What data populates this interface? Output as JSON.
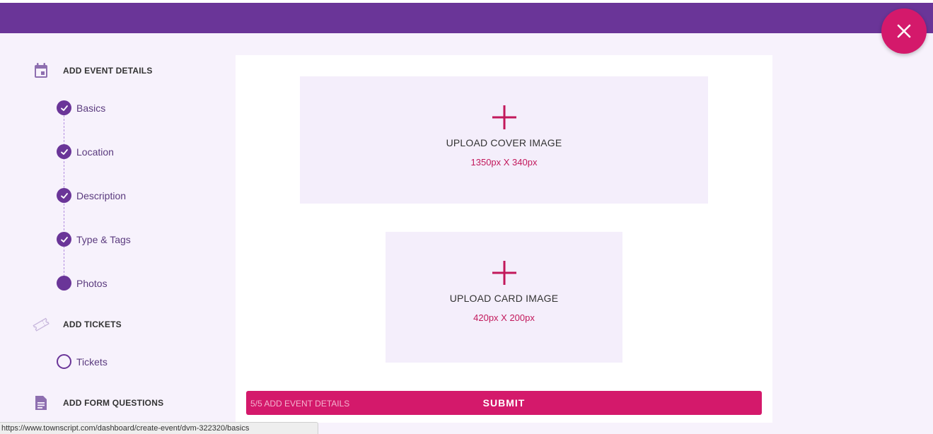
{
  "colors": {
    "brand": "#6a3598",
    "accent": "#d4196b"
  },
  "header": {
    "close_icon": "close-icon"
  },
  "sidebar": {
    "sections": [
      {
        "title": "ADD EVENT DETAILS",
        "icon": "calendar-icon",
        "steps": [
          {
            "label": "Basics",
            "status": "done"
          },
          {
            "label": "Location",
            "status": "done"
          },
          {
            "label": "Description",
            "status": "done"
          },
          {
            "label": "Type & Tags",
            "status": "done"
          },
          {
            "label": "Photos",
            "status": "current"
          }
        ]
      },
      {
        "title": "ADD TICKETS",
        "icon": "ticket-icon",
        "steps": [
          {
            "label": "Tickets",
            "status": "pending"
          }
        ]
      },
      {
        "title": "ADD FORM QUESTIONS",
        "icon": "document-icon",
        "steps": []
      }
    ]
  },
  "main": {
    "cover_upload": {
      "label": "UPLOAD COVER IMAGE",
      "size": "1350px X 340px"
    },
    "card_upload": {
      "label": "UPLOAD CARD IMAGE",
      "size": "420px X 200px"
    },
    "submit": {
      "progress": "5/5 ADD EVENT DETAILS",
      "label": "SUBMIT"
    }
  },
  "status_url": "https://www.townscript.com/dashboard/create-event/dvm-322320/basics"
}
